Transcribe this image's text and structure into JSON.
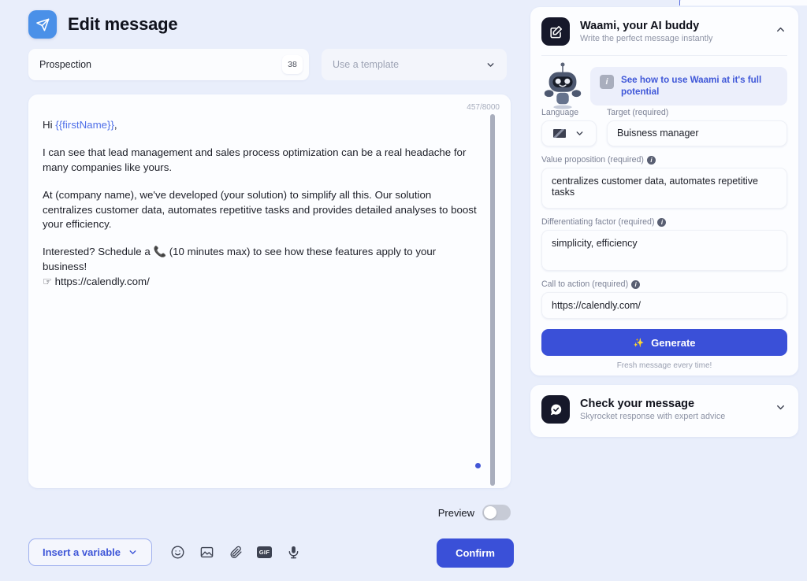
{
  "header": {
    "title": "Edit message",
    "logo_icon": "send-paper-plane-icon",
    "accent_color": "#4a90e8"
  },
  "subhead": {
    "name_value": "Prospection",
    "char_badge": "38",
    "template_placeholder": "Use a template",
    "template_chevron_icon": "chevron-down-icon"
  },
  "editor": {
    "char_count": "457/8000",
    "greeting_prefix": "Hi ",
    "greeting_variable": "{{firstName}}",
    "greeting_suffix": ",",
    "paragraph_2": "I can see that lead management and sales process optimization can be a real headache for many companies like yours.",
    "paragraph_3": "At (company name), we've developed (your solution) to simplify all this. Our solution centralizes customer data, automates repetitive tasks and provides detailed analyses to boost your efficiency.",
    "paragraph_4_line1": "Interested? Schedule a 📞 (10 minutes max) to see how these features apply to your business!",
    "paragraph_4_line2": "☞ https://calendly.com/"
  },
  "preview": {
    "label": "Preview",
    "state": "off"
  },
  "toolbar": {
    "insert_variable_label": "Insert a variable",
    "insert_variable_chevron": "chevron-down-icon",
    "icons": [
      {
        "name": "emoji-smiley-icon",
        "label": "Emoji"
      },
      {
        "name": "image-icon",
        "label": "Image"
      },
      {
        "name": "paperclip-icon",
        "label": "Attachment"
      },
      {
        "name": "gif-icon",
        "label": "GIF"
      },
      {
        "name": "microphone-icon",
        "label": "Voice"
      }
    ],
    "gif_label": "GIF",
    "confirm_label": "Confirm",
    "confirm_color": "#3a50d8"
  },
  "waami_card": {
    "tile_icon": "edit-square-pencil-icon",
    "title": "Waami, your AI buddy",
    "subtitle": "Write the perfect message instantly",
    "collapse_icon": "chevron-up-icon",
    "mascot_icon": "robot-mascot-icon",
    "hint_info_icon": "info-icon",
    "hint_text": "See how to use Waami at it's full potential",
    "hint_link_color": "#3f57d8",
    "fields": {
      "language_label": "Language",
      "language_flag_icon": "uk-flag-icon",
      "language_chevron": "chevron-down-icon",
      "target_label": "Target (required)",
      "target_value": "Buisness manager",
      "value_prop_label": "Value proposition (required)",
      "value_prop_value": "centralizes customer data, automates repetitive tasks",
      "diff_factor_label": "Differentiating factor (required)",
      "diff_factor_value": "simplicity, efficiency",
      "cta_label": "Call to action (required)",
      "cta_value": "https://calendly.com/"
    },
    "generate_label": "Generate",
    "generate_icon": "sparkles-icon",
    "generate_color": "#3a50d8",
    "fresh_note": "Fresh message every time!"
  },
  "check_card": {
    "tile_icon": "chat-check-icon",
    "title": "Check your message",
    "subtitle": "Skyrocket response with expert advice",
    "expand_icon": "chevron-down-icon"
  }
}
